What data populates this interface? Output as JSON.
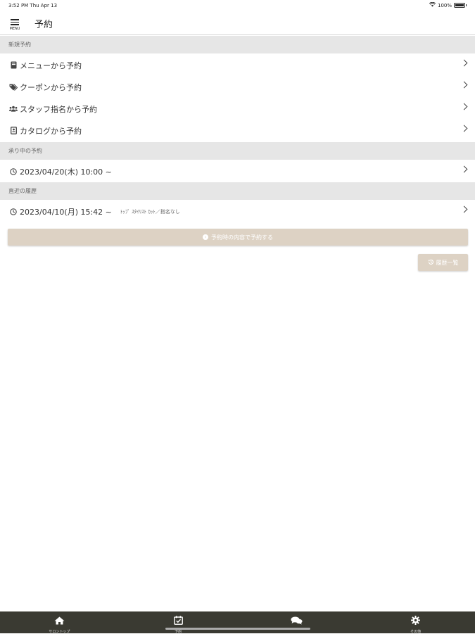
{
  "status_bar": {
    "time": "3:52 PM   Thu Apr 13",
    "battery": "100%"
  },
  "header": {
    "menu_label": "MENU",
    "title": "予約"
  },
  "new_reservation": {
    "section_title": "新規予約",
    "items": [
      {
        "label": "メニューから予約",
        "icon": "book-icon"
      },
      {
        "label": "クーポンから予約",
        "icon": "tags-icon"
      },
      {
        "label": "スタッフ指名から予約",
        "icon": "users-icon"
      },
      {
        "label": "カタログから予約",
        "icon": "catalog-icon"
      }
    ]
  },
  "upcoming": {
    "section_title": "承り中の予約",
    "items": [
      {
        "label": "2023/04/20(木) 10:00 ~",
        "icon": "clock-icon"
      }
    ]
  },
  "recent_history": {
    "section_title": "直近の履歴",
    "items": [
      {
        "label": "2023/04/10(月) 15:42 ~",
        "note": "ﾄｯﾌﾟ ｽﾀｲﾘｽﾄ ｶｯﾄ／指名なし",
        "icon": "clock-icon"
      }
    ]
  },
  "rebook_button": {
    "label": "予約時の内容で予約する"
  },
  "history_button": {
    "label": "履歴一覧"
  },
  "tab_bar": {
    "tabs": [
      {
        "label": "サロントップ",
        "icon": "home-icon"
      },
      {
        "label": "予約",
        "icon": "calendar-check-icon",
        "active": true
      },
      {
        "label": "",
        "icon": "chat-icon"
      },
      {
        "label": "その他",
        "icon": "gear-icon"
      }
    ]
  },
  "colors": {
    "accent_button": "#ddd2c4",
    "section_bg": "#e6e6e6",
    "tab_bar_bg": "#3a3a32"
  }
}
